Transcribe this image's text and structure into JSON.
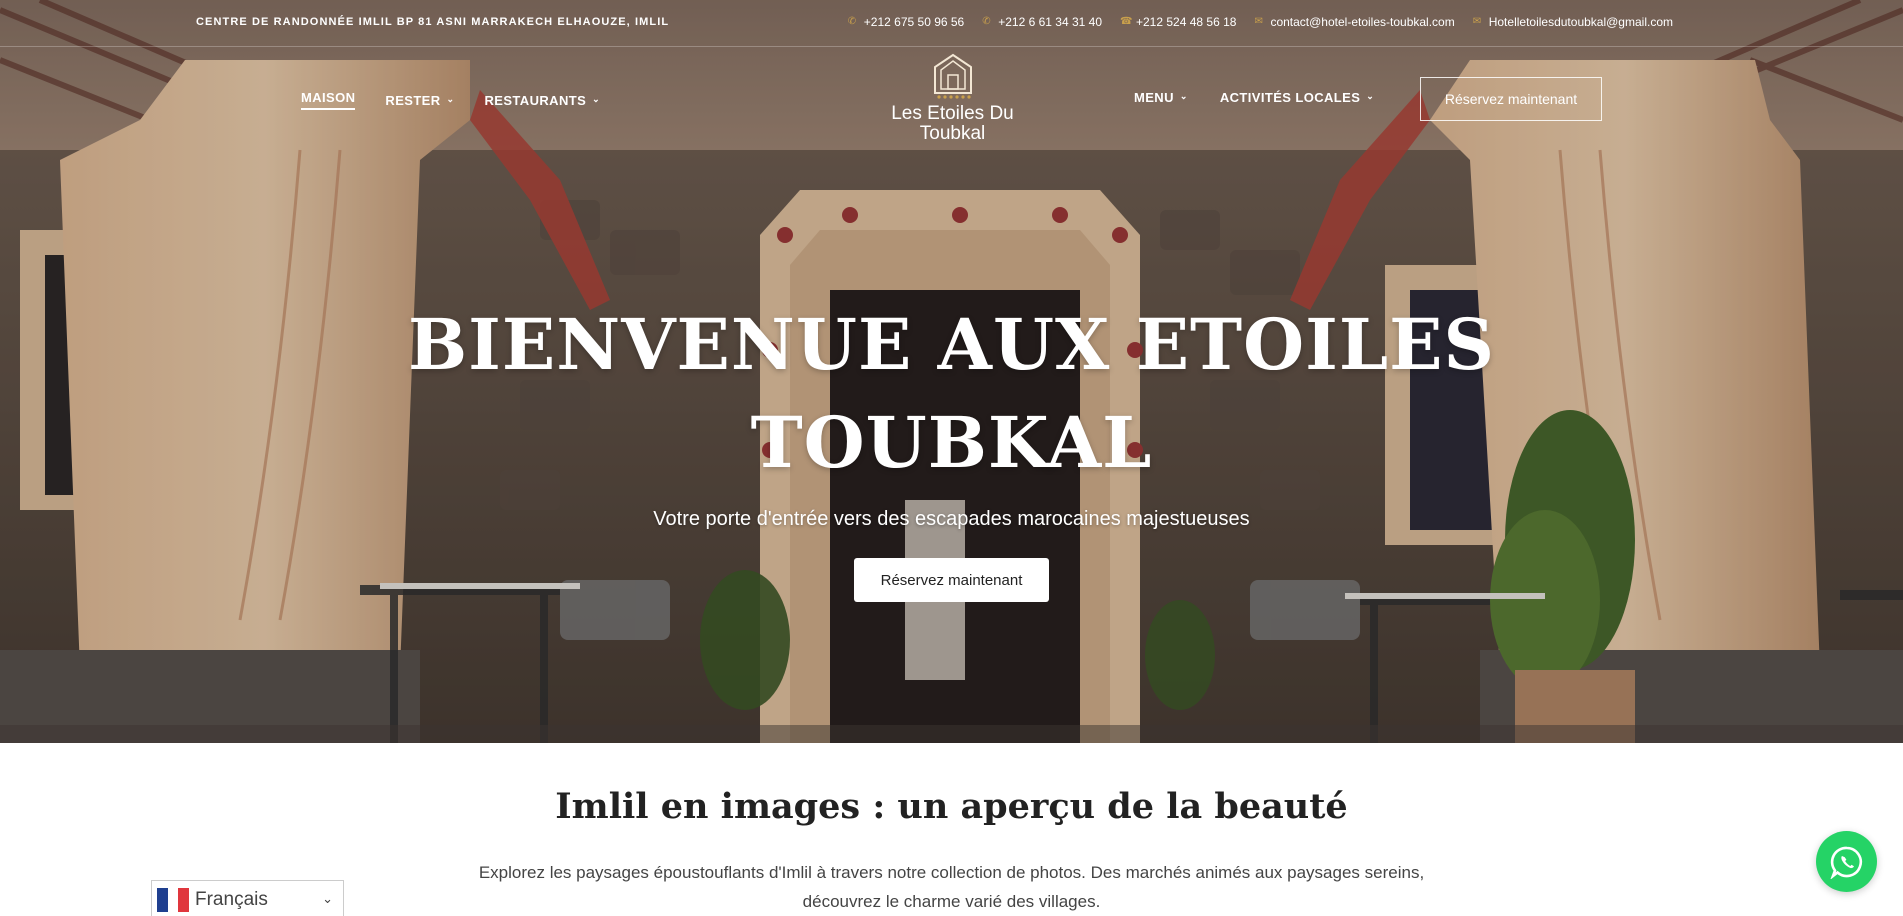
{
  "topbar": {
    "address": "CENTRE DE RANDONNÉE IMLIL BP 81 ASNI MARRAKECH ELHAOUZE, IMLIL",
    "phones": [
      "+212 675 50 96 56",
      "+212 6 61 34 31 40",
      "+212 524 48 56 18"
    ],
    "emails": [
      "contact@hotel-etoiles-toubkal.com",
      "Hotelletoilesdutoubkal@gmail.com"
    ]
  },
  "nav": {
    "left": [
      {
        "label": "MAISON",
        "active": true,
        "dropdown": false
      },
      {
        "label": "RESTER",
        "active": false,
        "dropdown": true
      },
      {
        "label": "RESTAURANTS",
        "active": false,
        "dropdown": true
      }
    ],
    "right": [
      {
        "label": "MENU",
        "dropdown": true
      },
      {
        "label": "ACTIVITÉS LOCALES",
        "dropdown": true
      }
    ],
    "reserve_label": "Réservez maintenant"
  },
  "logo": {
    "line1": "Les Etoiles Du",
    "line2": "Toubkal"
  },
  "hero": {
    "title_line1": "BIENVENUE AUX ETOILES",
    "title_line2": "TOUBKAL",
    "subtitle": "Votre porte d'entrée vers des escapades marocaines majestueuses",
    "button_label": "Réservez maintenant"
  },
  "section": {
    "title": "Imlil en images : un aperçu de la beauté",
    "description": "Explorez les paysages époustouflants d'Imlil à travers notre collection de photos. Des marchés animés aux paysages sereins, découvrez le charme varié des villages."
  },
  "language": {
    "label": "Français"
  },
  "colors": {
    "accent_gold": "#c9a04c",
    "whatsapp": "#25d366"
  }
}
